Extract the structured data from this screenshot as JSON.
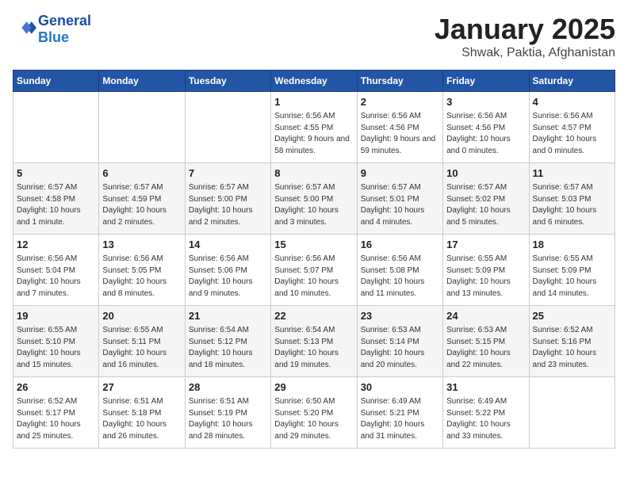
{
  "header": {
    "logo_line1": "General",
    "logo_line2": "Blue",
    "title": "January 2025",
    "subtitle": "Shwak, Paktia, Afghanistan"
  },
  "days_of_week": [
    "Sunday",
    "Monday",
    "Tuesday",
    "Wednesday",
    "Thursday",
    "Friday",
    "Saturday"
  ],
  "weeks": [
    [
      {
        "day": "",
        "info": ""
      },
      {
        "day": "",
        "info": ""
      },
      {
        "day": "",
        "info": ""
      },
      {
        "day": "1",
        "info": "Sunrise: 6:56 AM\nSunset: 4:55 PM\nDaylight: 9 hours and 58 minutes."
      },
      {
        "day": "2",
        "info": "Sunrise: 6:56 AM\nSunset: 4:56 PM\nDaylight: 9 hours and 59 minutes."
      },
      {
        "day": "3",
        "info": "Sunrise: 6:56 AM\nSunset: 4:56 PM\nDaylight: 10 hours and 0 minutes."
      },
      {
        "day": "4",
        "info": "Sunrise: 6:56 AM\nSunset: 4:57 PM\nDaylight: 10 hours and 0 minutes."
      }
    ],
    [
      {
        "day": "5",
        "info": "Sunrise: 6:57 AM\nSunset: 4:58 PM\nDaylight: 10 hours and 1 minute."
      },
      {
        "day": "6",
        "info": "Sunrise: 6:57 AM\nSunset: 4:59 PM\nDaylight: 10 hours and 2 minutes."
      },
      {
        "day": "7",
        "info": "Sunrise: 6:57 AM\nSunset: 5:00 PM\nDaylight: 10 hours and 2 minutes."
      },
      {
        "day": "8",
        "info": "Sunrise: 6:57 AM\nSunset: 5:00 PM\nDaylight: 10 hours and 3 minutes."
      },
      {
        "day": "9",
        "info": "Sunrise: 6:57 AM\nSunset: 5:01 PM\nDaylight: 10 hours and 4 minutes."
      },
      {
        "day": "10",
        "info": "Sunrise: 6:57 AM\nSunset: 5:02 PM\nDaylight: 10 hours and 5 minutes."
      },
      {
        "day": "11",
        "info": "Sunrise: 6:57 AM\nSunset: 5:03 PM\nDaylight: 10 hours and 6 minutes."
      }
    ],
    [
      {
        "day": "12",
        "info": "Sunrise: 6:56 AM\nSunset: 5:04 PM\nDaylight: 10 hours and 7 minutes."
      },
      {
        "day": "13",
        "info": "Sunrise: 6:56 AM\nSunset: 5:05 PM\nDaylight: 10 hours and 8 minutes."
      },
      {
        "day": "14",
        "info": "Sunrise: 6:56 AM\nSunset: 5:06 PM\nDaylight: 10 hours and 9 minutes."
      },
      {
        "day": "15",
        "info": "Sunrise: 6:56 AM\nSunset: 5:07 PM\nDaylight: 10 hours and 10 minutes."
      },
      {
        "day": "16",
        "info": "Sunrise: 6:56 AM\nSunset: 5:08 PM\nDaylight: 10 hours and 11 minutes."
      },
      {
        "day": "17",
        "info": "Sunrise: 6:55 AM\nSunset: 5:09 PM\nDaylight: 10 hours and 13 minutes."
      },
      {
        "day": "18",
        "info": "Sunrise: 6:55 AM\nSunset: 5:09 PM\nDaylight: 10 hours and 14 minutes."
      }
    ],
    [
      {
        "day": "19",
        "info": "Sunrise: 6:55 AM\nSunset: 5:10 PM\nDaylight: 10 hours and 15 minutes."
      },
      {
        "day": "20",
        "info": "Sunrise: 6:55 AM\nSunset: 5:11 PM\nDaylight: 10 hours and 16 minutes."
      },
      {
        "day": "21",
        "info": "Sunrise: 6:54 AM\nSunset: 5:12 PM\nDaylight: 10 hours and 18 minutes."
      },
      {
        "day": "22",
        "info": "Sunrise: 6:54 AM\nSunset: 5:13 PM\nDaylight: 10 hours and 19 minutes."
      },
      {
        "day": "23",
        "info": "Sunrise: 6:53 AM\nSunset: 5:14 PM\nDaylight: 10 hours and 20 minutes."
      },
      {
        "day": "24",
        "info": "Sunrise: 6:53 AM\nSunset: 5:15 PM\nDaylight: 10 hours and 22 minutes."
      },
      {
        "day": "25",
        "info": "Sunrise: 6:52 AM\nSunset: 5:16 PM\nDaylight: 10 hours and 23 minutes."
      }
    ],
    [
      {
        "day": "26",
        "info": "Sunrise: 6:52 AM\nSunset: 5:17 PM\nDaylight: 10 hours and 25 minutes."
      },
      {
        "day": "27",
        "info": "Sunrise: 6:51 AM\nSunset: 5:18 PM\nDaylight: 10 hours and 26 minutes."
      },
      {
        "day": "28",
        "info": "Sunrise: 6:51 AM\nSunset: 5:19 PM\nDaylight: 10 hours and 28 minutes."
      },
      {
        "day": "29",
        "info": "Sunrise: 6:50 AM\nSunset: 5:20 PM\nDaylight: 10 hours and 29 minutes."
      },
      {
        "day": "30",
        "info": "Sunrise: 6:49 AM\nSunset: 5:21 PM\nDaylight: 10 hours and 31 minutes."
      },
      {
        "day": "31",
        "info": "Sunrise: 6:49 AM\nSunset: 5:22 PM\nDaylight: 10 hours and 33 minutes."
      },
      {
        "day": "",
        "info": ""
      }
    ]
  ]
}
